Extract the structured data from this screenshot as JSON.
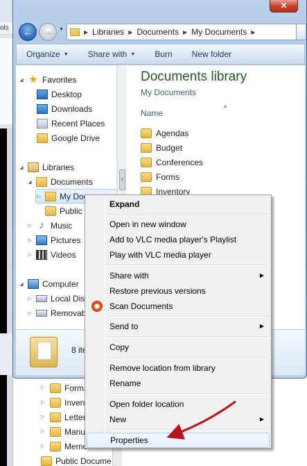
{
  "background_window": {
    "toolbar_fragment": "ols"
  },
  "window": {
    "close_glyph": "✕",
    "address": {
      "crumbs": [
        "Libraries",
        "Documents",
        "My Documents"
      ]
    },
    "toolbar": [
      {
        "label": "Organize",
        "dropdown": true
      },
      {
        "label": "Share with",
        "dropdown": true
      },
      {
        "label": "Burn",
        "dropdown": false
      },
      {
        "label": "New folder",
        "dropdown": false
      }
    ],
    "nav": {
      "favorites": "Favorites",
      "desktop": "Desktop",
      "downloads": "Downloads",
      "recent": "Recent Places",
      "gdrive": "Google Drive",
      "libraries": "Libraries",
      "documents": "Documents",
      "my_documents": "My Doc",
      "public": "Public I",
      "music": "Music",
      "pictures": "Pictures",
      "videos": "Videos",
      "computer": "Computer",
      "local_disk": "Local Dis",
      "removable": "Removab"
    },
    "content": {
      "title": "Documents library",
      "subtitle": "My Documents",
      "column": "Name",
      "files": [
        "Agendas",
        "Budget",
        "Conferences",
        "Forms",
        "Inventory"
      ]
    },
    "status": {
      "text": "8 ite"
    }
  },
  "lower_pane": {
    "items": [
      "Forms",
      "Invent",
      "Letter",
      "Manu",
      "Memo",
      "Public Docume"
    ]
  },
  "context_menu": {
    "expand": "Expand",
    "open_new_window": "Open in new window",
    "add_vlc_playlist": "Add to VLC media player's Playlist",
    "play_vlc": "Play with VLC media player",
    "share_with": "Share with",
    "restore": "Restore previous versions",
    "scan": "Scan Documents",
    "send_to": "Send to",
    "copy": "Copy",
    "remove_location": "Remove location from library",
    "rename": "Rename",
    "open_folder_location": "Open folder location",
    "new": "New",
    "properties": "Properties"
  },
  "colors": {
    "annotation_arrow": "#b8141c",
    "library_title": "#1e5b1e"
  }
}
